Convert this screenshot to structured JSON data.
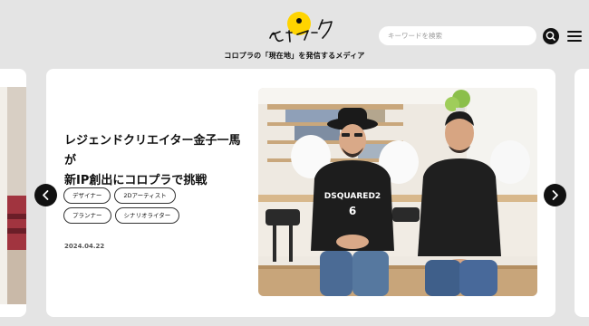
{
  "header": {
    "logo_text": "ピンマーク",
    "tagline": "コロプラの「現在地」を発信するメディア",
    "search_placeholder": "キーワードを検索"
  },
  "carousel": {
    "active_slide": {
      "title_line1": "レジェンドクリエイター金子一馬が",
      "title_line2": "新IP創出にコロプラで挑戦",
      "tags": [
        "デザイナー",
        "2Dアーティスト",
        "プランナー",
        "シナリオライター"
      ],
      "date": "2024.04.22",
      "shirt_text": "DSQUARED2",
      "shirt_number": "6"
    }
  },
  "icons": [
    "pin-logo-icon",
    "search-icon",
    "menu-icon",
    "chevron-left-icon",
    "chevron-right-icon"
  ],
  "colors": {
    "accent_yellow": "#ffd400",
    "background": "#e4e4e4",
    "card": "#ffffff",
    "dark": "#111111"
  }
}
